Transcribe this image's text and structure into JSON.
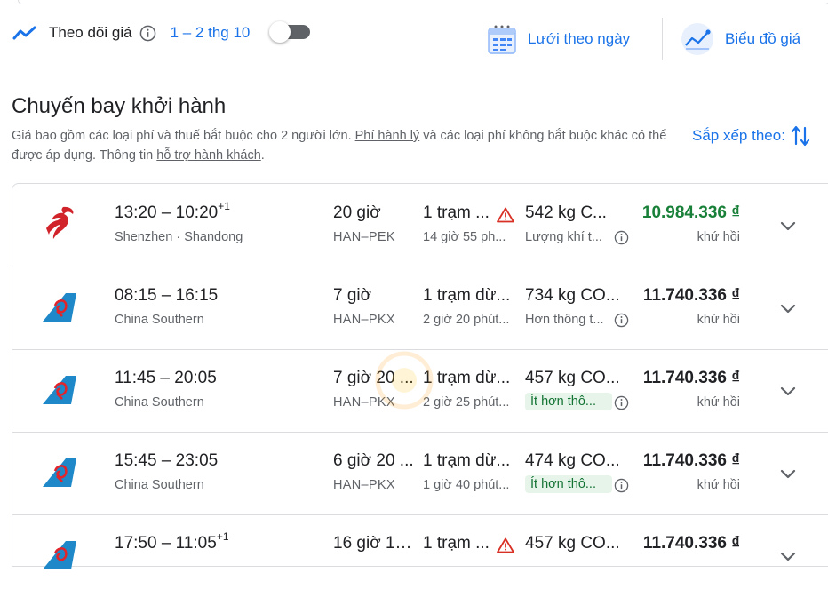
{
  "tracking": {
    "label": "Theo dõi giá",
    "dates": "1 – 2 thg 10",
    "enabled": false
  },
  "views": {
    "date_grid": "Lưới theo ngày",
    "price_graph": "Biểu đồ giá"
  },
  "section": {
    "title": "Chuyến bay khởi hành",
    "disclaimer_pre": "Giá bao gồm các loại phí và thuế bắt buộc cho 2 người lớn. ",
    "baggage_link": "Phí hành lý",
    "disclaimer_mid": " và các loại phí không bắt buộc khác có thể được áp dụng. Thông tin ",
    "help_link": "hỗ trợ hành khách",
    "disclaimer_end": ".",
    "sort_label": "Sắp xếp theo:"
  },
  "flights": [
    {
      "dep": "13:20",
      "arr": "10:20",
      "arr_offset": "+1",
      "airline": "Shenzhen · Shandong",
      "duration": "20 giờ",
      "route": "HAN–PEK",
      "stops": "1 trạm ...",
      "layover": "14 giờ 55 ph...",
      "co2": "542 kg C...",
      "emissions": "Lượng khí t...",
      "price": "10.984.336 ₫",
      "price_type": "khứ hồi"
    },
    {
      "dep": "08:15",
      "arr": "16:15",
      "arr_offset": "",
      "airline": "China Southern",
      "duration": "7 giờ",
      "route": "HAN–PKX",
      "stops": "1 trạm dừ...",
      "layover": "2 giờ 20 phút...",
      "co2": "734 kg CO...",
      "emissions": "Hơn thông t...",
      "price": "11.740.336 ₫",
      "price_type": "khứ hồi"
    },
    {
      "dep": "11:45",
      "arr": "20:05",
      "arr_offset": "",
      "airline": "China Southern",
      "duration": "7 giờ 20 ...",
      "route": "HAN–PKX",
      "stops": "1 trạm dừ...",
      "layover": "2 giờ 25 phút...",
      "co2": "457 kg CO...",
      "emissions": "Ít hơn thô...",
      "price": "11.740.336 ₫",
      "price_type": "khứ hồi"
    },
    {
      "dep": "15:45",
      "arr": "23:05",
      "arr_offset": "",
      "airline": "China Southern",
      "duration": "6 giờ 20 ...",
      "route": "HAN–PKX",
      "stops": "1 trạm dừ...",
      "layover": "1 giờ 40 phút...",
      "co2": "474 kg CO...",
      "emissions": "Ít hơn thô...",
      "price": "11.740.336 ₫",
      "price_type": "khứ hồi"
    },
    {
      "dep": "17:50",
      "arr": "11:05",
      "arr_offset": "+1",
      "airline": "",
      "duration": "16 giờ 15 ...",
      "route": "",
      "stops": "1 trạm ...",
      "layover": "",
      "co2": "457 kg CO...",
      "emissions": "",
      "price": "11.740.336 ₫",
      "price_type": ""
    }
  ],
  "colors": {
    "accent": "#1a73e8",
    "price_best": "#188038",
    "eco_badge_bg": "#e6f4ea",
    "eco_badge_text": "#137333",
    "warning": "#d93025"
  }
}
